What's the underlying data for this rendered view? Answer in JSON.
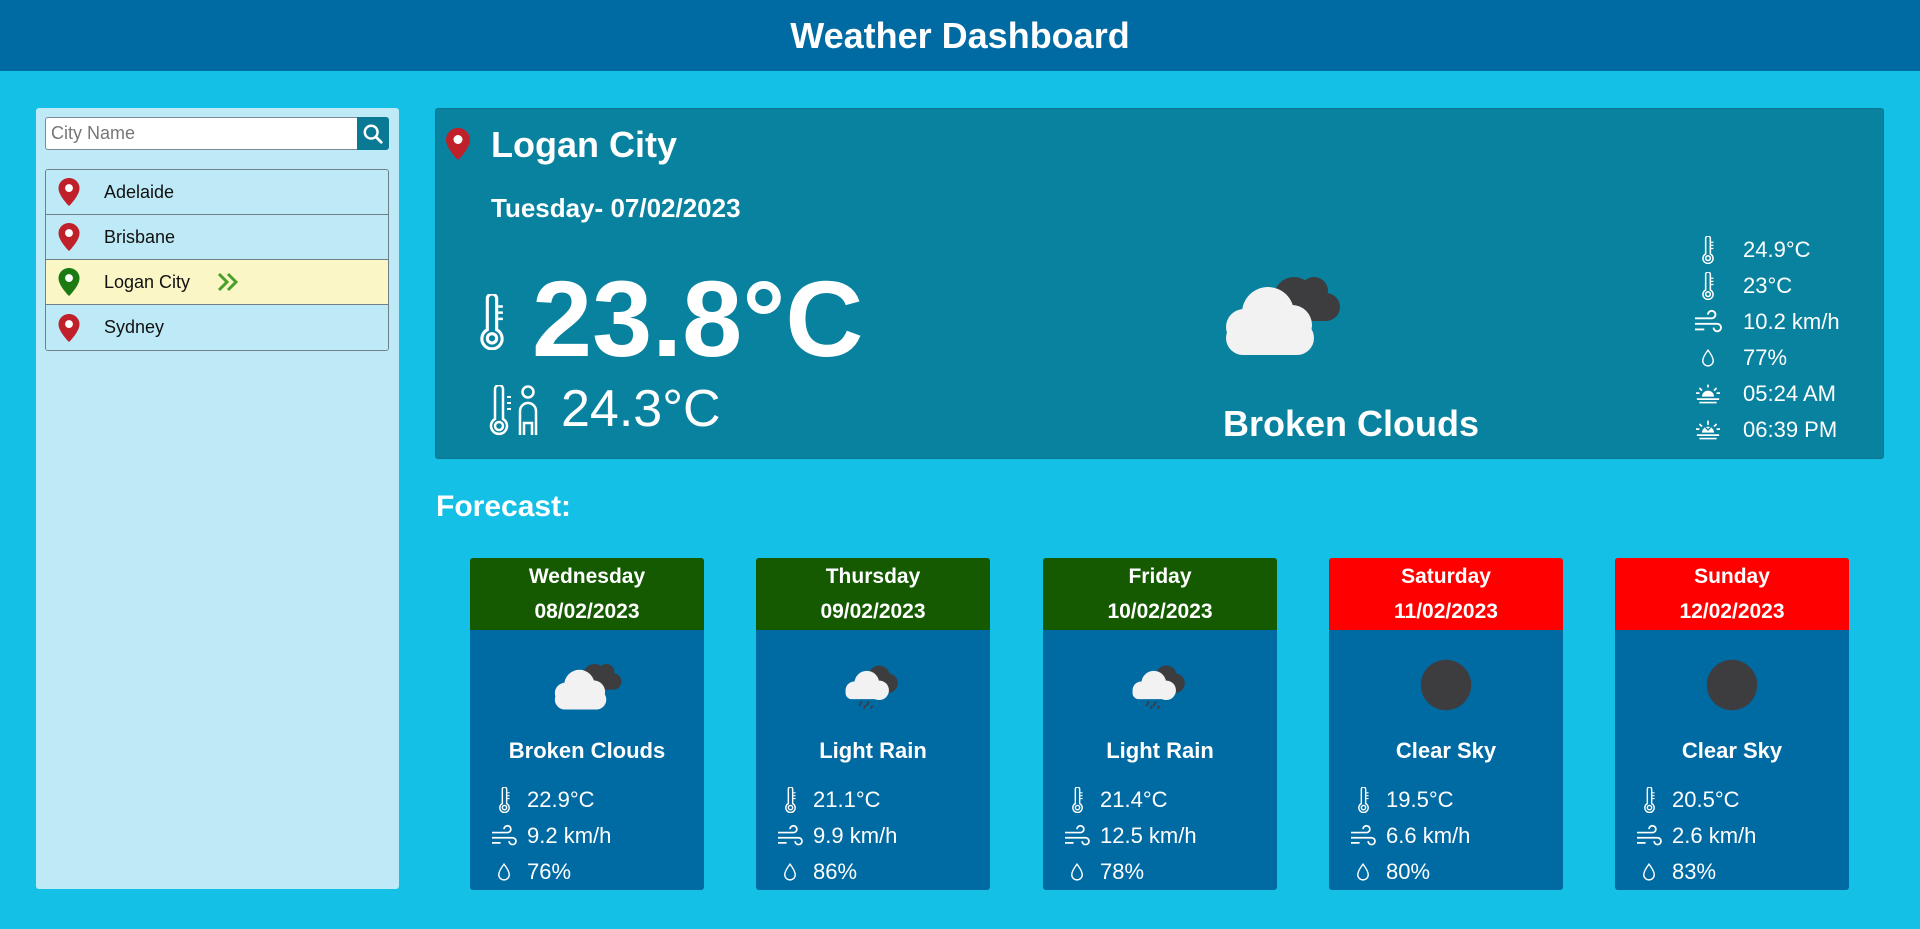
{
  "header": {
    "title": "Weather Dashboard"
  },
  "search": {
    "placeholder": "City Name"
  },
  "cities": [
    {
      "name": "Adelaide",
      "active": false
    },
    {
      "name": "Brisbane",
      "active": false
    },
    {
      "name": "Logan City",
      "active": true
    },
    {
      "name": "Sydney",
      "active": false
    }
  ],
  "current": {
    "city": "Logan City",
    "date": "Tuesday- 07/02/2023",
    "temp": "23.8°C",
    "feels_like": "24.3°C",
    "description": "Broken Clouds",
    "icon": "broken-clouds",
    "details": {
      "temp_max": "24.9°C",
      "temp_min": "23°C",
      "wind": "10.2 km/h",
      "humidity": "77%",
      "sunrise": "05:24 AM",
      "sunset": "06:39 PM"
    }
  },
  "forecast": {
    "title": "Forecast:",
    "days": [
      {
        "day": "Wednesday",
        "date": "08/02/2023",
        "weekend": false,
        "icon": "broken-clouds",
        "description": "Broken Clouds",
        "temp": "22.9°C",
        "wind": "9.2 km/h",
        "humidity": "76%"
      },
      {
        "day": "Thursday",
        "date": "09/02/2023",
        "weekend": false,
        "icon": "light-rain",
        "description": "Light Rain",
        "temp": "21.1°C",
        "wind": "9.9 km/h",
        "humidity": "86%"
      },
      {
        "day": "Friday",
        "date": "10/02/2023",
        "weekend": false,
        "icon": "light-rain",
        "description": "Light Rain",
        "temp": "21.4°C",
        "wind": "12.5 km/h",
        "humidity": "78%"
      },
      {
        "day": "Saturday",
        "date": "11/02/2023",
        "weekend": true,
        "icon": "clear-sky",
        "description": "Clear Sky",
        "temp": "19.5°C",
        "wind": "6.6 km/h",
        "humidity": "80%"
      },
      {
        "day": "Sunday",
        "date": "12/02/2023",
        "weekend": true,
        "icon": "clear-sky",
        "description": "Clear Sky",
        "temp": "20.5°C",
        "wind": "2.6 km/h",
        "humidity": "83%"
      }
    ]
  },
  "colors": {
    "background": "#14c0e6",
    "header": "#006aa3",
    "sidebar": "#bdeaf6",
    "current_panel": "#09829f",
    "card": "#006aa3",
    "weekday_head": "#155a00",
    "weekend_head": "#ff0000",
    "active_city": "#faf6c5",
    "pin_red": "#c0202a",
    "pin_green": "#1b7a12"
  }
}
